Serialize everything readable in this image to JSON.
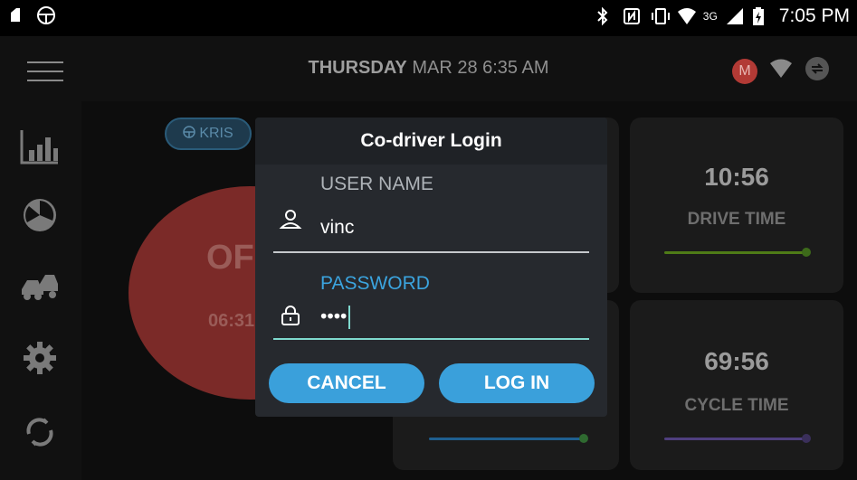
{
  "status_bar": {
    "time": "7:05 PM",
    "network": "3G",
    "icons": [
      "notification-icon",
      "steering-wheel-icon",
      "bluetooth-icon",
      "nfc-icon",
      "vibrate-icon",
      "wifi-icon",
      "signal-icon",
      "battery-charging-icon"
    ]
  },
  "header": {
    "day": "THURSDAY",
    "date_time": "MAR 28 6:35 AM",
    "avatar_letter": "M"
  },
  "sidebar": {
    "items": [
      "chart-icon",
      "logs-icon",
      "vehicles-icon",
      "settings-icon",
      "sync-icon"
    ]
  },
  "dashboard": {
    "driver_name": "KRIS",
    "duty_status": "OFF",
    "duty_time": "06:31",
    "drive_time": "10:56",
    "drive_label": "DRIVE TIME",
    "cycle_time": "69:56",
    "cycle_label": "CYCLE TIME",
    "colors": {
      "drive_bar": "#4f7c17",
      "shift_bar": "#1f5f8f",
      "cycle_bar": "#4f3f7f"
    }
  },
  "dialog": {
    "title": "Co-driver Login",
    "username_label": "USER NAME",
    "username_value": "vinc",
    "password_label": "PASSWORD",
    "password_value": "••••",
    "cancel_label": "CANCEL",
    "login_label": "LOG IN",
    "accent": "#3aa0db"
  }
}
